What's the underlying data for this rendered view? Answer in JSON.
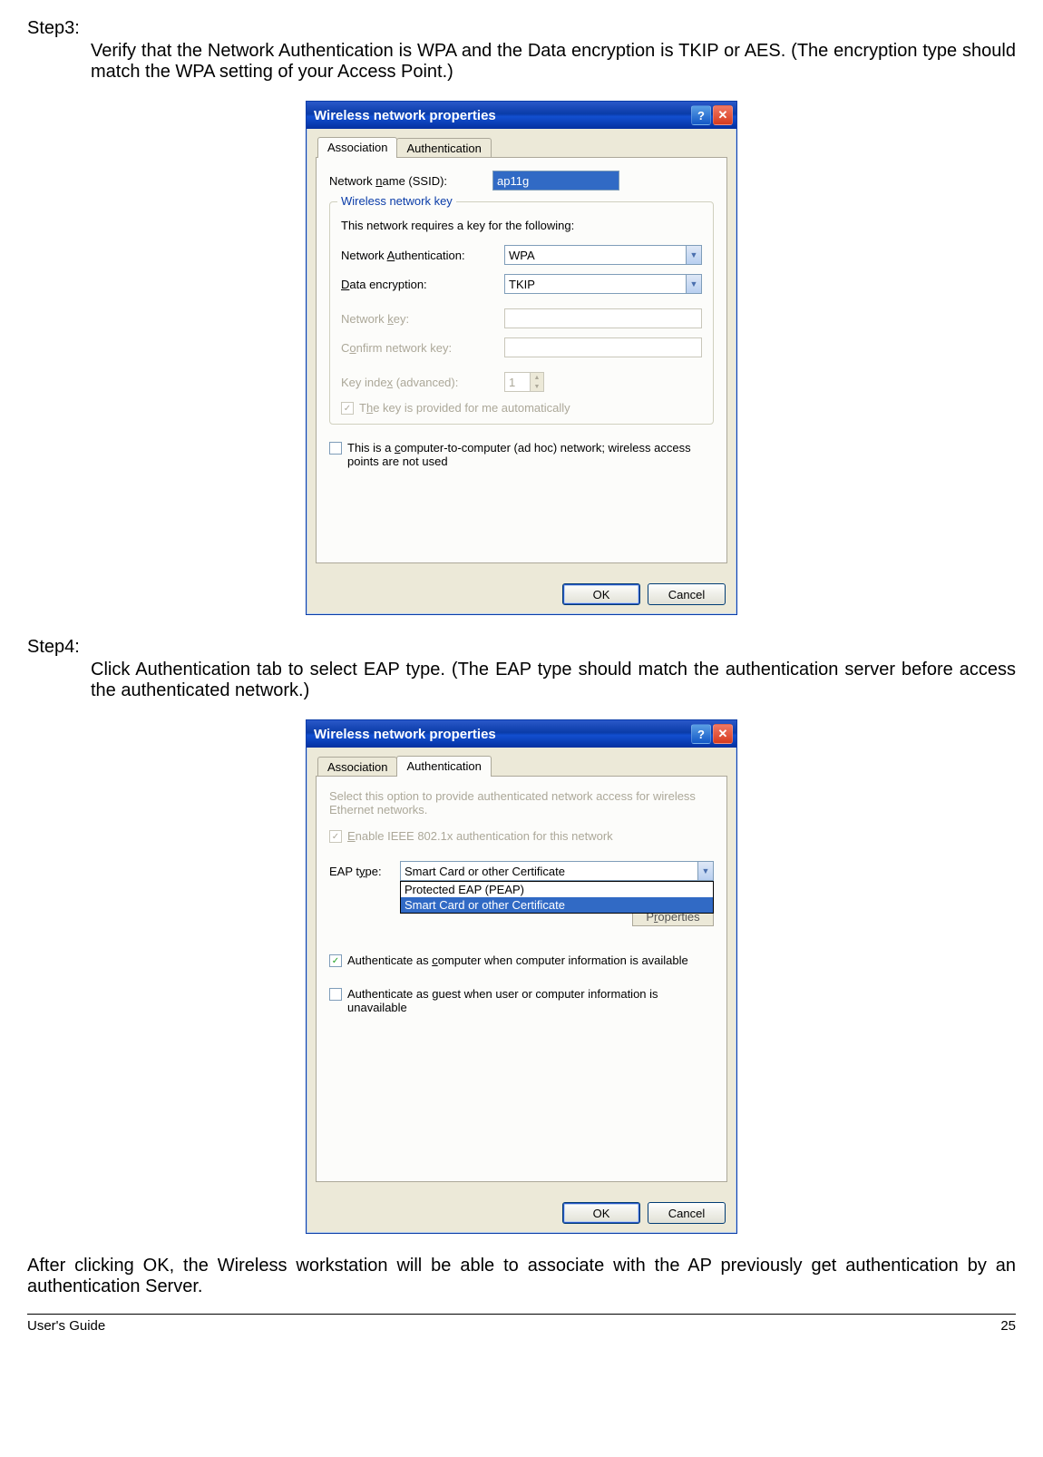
{
  "steps": {
    "s3": {
      "label": "Step3:",
      "text": "Verify that the Network Authentication is WPA and the Data encryption is TKIP or AES. (The encryption type should match the WPA setting of your Access Point.)"
    },
    "s4": {
      "label": "Step4:",
      "text": "Click Authentication tab to select EAP type. (The EAP type should match the authentication server before access the authenticated network.)"
    },
    "outro": "After clicking OK, the Wireless workstation will be able to associate with the AP previously get authentication by an authentication Server."
  },
  "dialog1": {
    "title": "Wireless network properties",
    "tabs": {
      "assoc": "Association",
      "auth": "Authentication"
    },
    "ssid_label": "Network name (SSID):",
    "ssid_value": "ap11g",
    "fieldset_legend": "Wireless network key",
    "requires_text": "This network requires a key for the following:",
    "netauth_label": "Network Authentication:",
    "netauth_value": "WPA",
    "dataenc_label": "Data encryption:",
    "dataenc_value": "TKIP",
    "netkey_label": "Network key:",
    "confirm_label": "Confirm network key:",
    "keyindex_label": "Key index (advanced):",
    "keyindex_value": "1",
    "auto_key_label": "The key is provided for me automatically",
    "adhoc_label": "This is a computer-to-computer (ad hoc) network; wireless access points are not used",
    "ok": "OK",
    "cancel": "Cancel"
  },
  "dialog2": {
    "title": "Wireless network properties",
    "tabs": {
      "assoc": "Association",
      "auth": "Authentication"
    },
    "info": "Select this option to provide authenticated network access for wireless Ethernet networks.",
    "enable_label": "Enable IEEE 802.1x authentication for this network",
    "eap_label": "EAP type:",
    "eap_value": "Smart Card or other Certificate",
    "eap_options": [
      "Protected EAP (PEAP)",
      "Smart Card or other Certificate"
    ],
    "properties_btn": "Properties",
    "auth_computer_label": "Authenticate as computer when computer information is available",
    "auth_guest_label": "Authenticate as guest when user or computer information is unavailable",
    "ok": "OK",
    "cancel": "Cancel"
  },
  "footer": {
    "left": "User's Guide",
    "right": "25"
  }
}
